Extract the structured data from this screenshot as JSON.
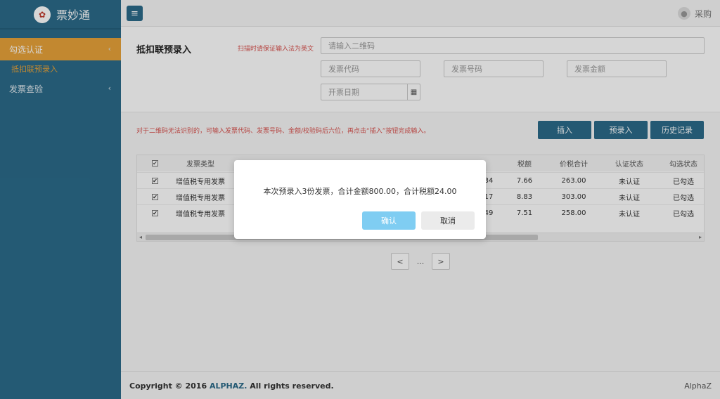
{
  "brand": {
    "name": "票妙通"
  },
  "sidebar": {
    "items": [
      {
        "label": "勾选认证",
        "chev": "‹"
      },
      {
        "label": "抵扣联预录入"
      },
      {
        "label": "发票查验",
        "chev": "‹"
      }
    ]
  },
  "header": {
    "menu_icon": "hamburger-icon",
    "user_name": "采购"
  },
  "form": {
    "title": "抵扣联预录入",
    "qr_hint": "扫描时请保证输入法为英文",
    "qr_placeholder": "请输入二维码",
    "code_placeholder": "发票代码",
    "number_placeholder": "发票号码",
    "amount_placeholder": "发票金额",
    "date_placeholder": "开票日期"
  },
  "actions": {
    "hint": "对于二维码无法识别的，可输入发票代码、发票号码、金额/校验码后六位，再点击“插入”按钮完成输入。",
    "insert": "插入",
    "pre_entry": "预录入",
    "history": "历史记录"
  },
  "table": {
    "headers": {
      "type": "发票类型",
      "tax": "税额",
      "total": "价税合计",
      "auth": "认证状态",
      "select": "勾选状态"
    },
    "rows": [
      {
        "type": "增值税专用发票",
        "amount_partial": "34",
        "tax": "7.66",
        "total": "263.00",
        "auth": "未认证",
        "select": "已勾选"
      },
      {
        "type": "增值税专用发票",
        "amount_partial": "17",
        "tax": "8.83",
        "total": "303.00",
        "auth": "未认证",
        "select": "已勾选"
      },
      {
        "type": "增值税专用发票",
        "amount_partial": "49",
        "tax": "7.51",
        "total": "258.00",
        "auth": "未认证",
        "select": "已勾选"
      }
    ]
  },
  "pager": {
    "prev": "<",
    "ellipsis": "...",
    "next": ">"
  },
  "footer": {
    "copy_prefix": "Copyright © 2016 ",
    "copy_brand": "ALPHAZ.",
    "copy_suffix": " All rights reserved.",
    "right": "AlphaZ"
  },
  "modal": {
    "message": "本次预录入3份发票，合计金额800.00，合计税额24.00",
    "confirm": "确认",
    "cancel": "取消"
  },
  "colors": {
    "sidebar": "#2b6b8a",
    "accent": "#e8a33a",
    "confirm": "#7fcdf2",
    "hint": "#d9534f"
  }
}
